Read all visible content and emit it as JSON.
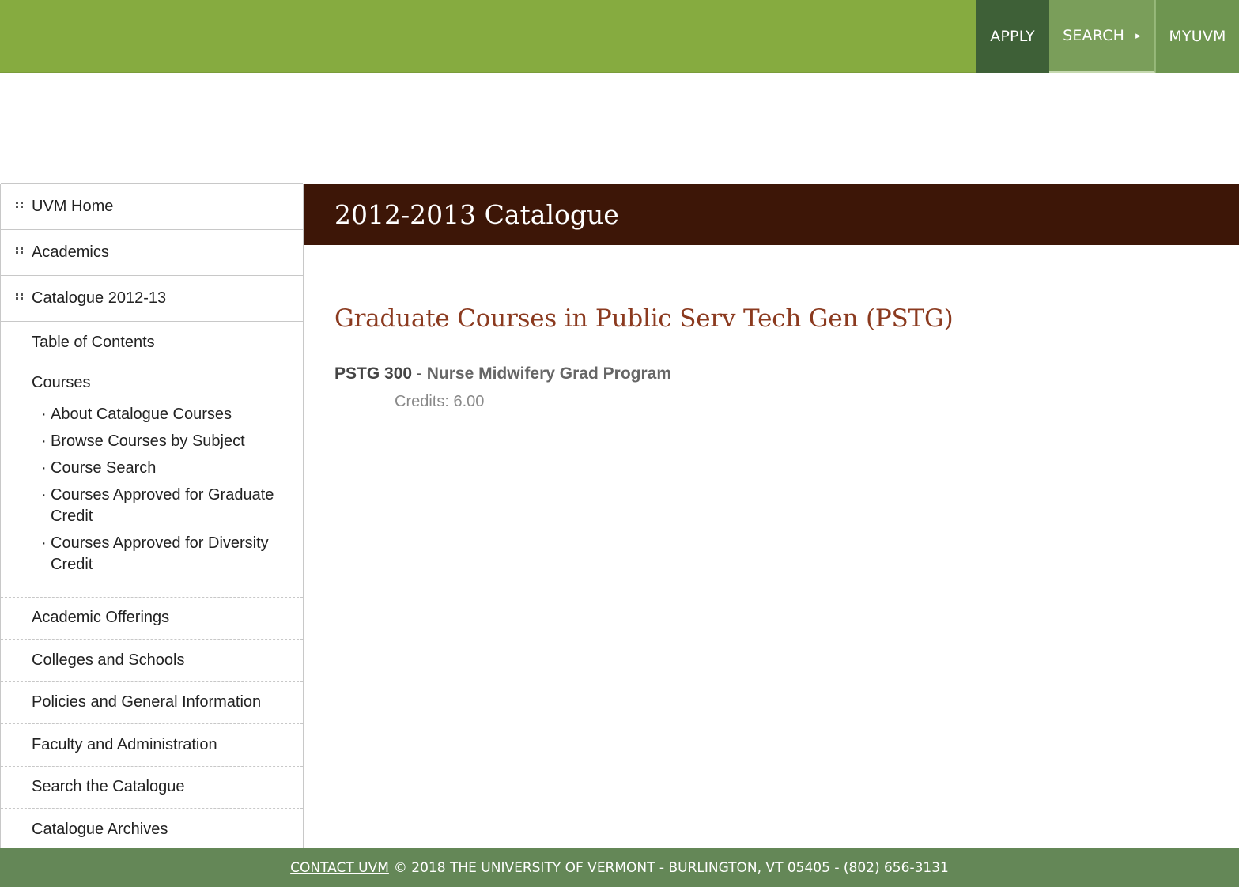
{
  "topnav": {
    "apply": "APPLY",
    "search": "SEARCH",
    "search_icon": "caret-right-icon",
    "myuvm": "MYUVM"
  },
  "sidebar": {
    "top_items": [
      "UVM Home",
      "Academics",
      "Catalogue 2012-13"
    ],
    "toc": "Table of Contents",
    "courses": {
      "label": "Courses",
      "sub_items": [
        "About Catalogue Courses",
        "Browse Courses by Subject",
        "Course Search",
        "Courses Approved for Graduate Credit",
        "Courses Approved for Diversity Credit"
      ]
    },
    "items": [
      "Academic Offerings",
      "Colleges and Schools",
      "Policies and General Information",
      "Faculty and Administration",
      "Search the Catalogue",
      "Catalogue Archives"
    ]
  },
  "main": {
    "band_title": "2012-2013 Catalogue",
    "heading": "Graduate Courses in Public Serv Tech Gen (PSTG)",
    "course": {
      "code": "PSTG 300",
      "separator": "-",
      "title": "Nurse Midwifery Grad Program",
      "credits": "Credits: 6.00"
    }
  },
  "footer": {
    "contact_link": "CONTACT UVM",
    "text": "© 2018 THE UNIVERSITY OF VERMONT - BURLINGTON, VT 05405 - (802) 656-3131"
  }
}
